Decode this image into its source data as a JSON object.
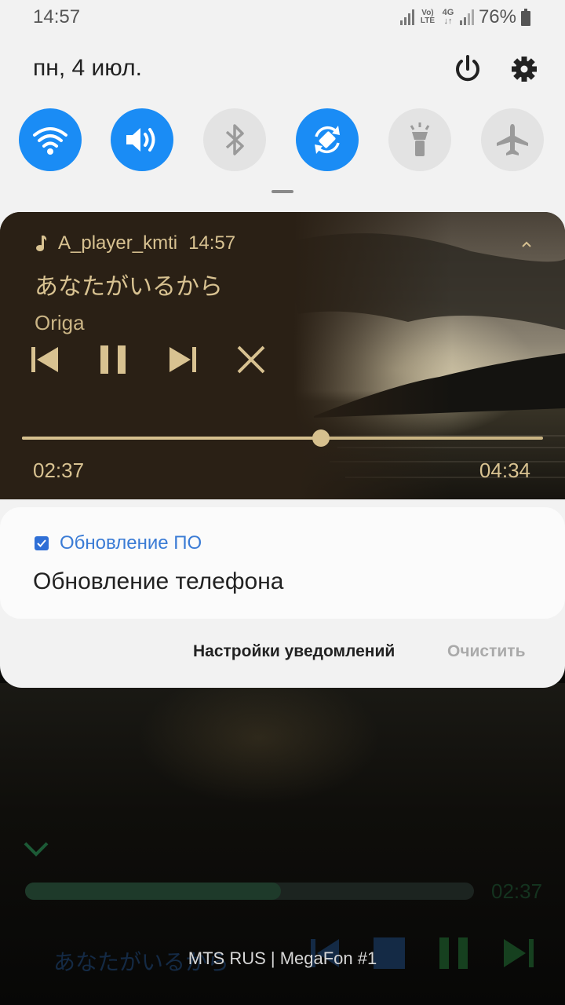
{
  "status_bar": {
    "time": "14:57",
    "network_icons": [
      "signal-icon",
      "volte-icon",
      "4g-icon",
      "signal-icon-2"
    ],
    "battery_percent": "76%",
    "volte_label": "Vo) LTE",
    "net_label": "4G"
  },
  "header": {
    "date": "пн, 4 июл."
  },
  "quick_settings": [
    {
      "name": "wifi",
      "icon": "wifi-icon",
      "on": true
    },
    {
      "name": "sound",
      "icon": "volume-icon",
      "on": true
    },
    {
      "name": "bluetooth",
      "icon": "bluetooth-icon",
      "on": false
    },
    {
      "name": "auto-rotate",
      "icon": "rotate-icon",
      "on": true
    },
    {
      "name": "flashlight",
      "icon": "flashlight-icon",
      "on": false
    },
    {
      "name": "airplane",
      "icon": "airplane-icon",
      "on": false
    }
  ],
  "media": {
    "app": "A_player_kmti",
    "time": "14:57",
    "title": "あなたがいるから",
    "artist": "Origa",
    "current_time": "02:37",
    "total_time": "04:34",
    "progress": 0.574,
    "accent": "#d8c291"
  },
  "system_notification": {
    "app": "Обновление ПО",
    "title": "Обновление телефона"
  },
  "footer": {
    "settings_label": "Настройки уведомлений",
    "clear_label": "Очистить"
  },
  "background_player": {
    "title": "あなたがいるから",
    "current_time": "02:37",
    "progress": 0.57
  },
  "carrier": "MTS RUS | MegaFon #1",
  "colors": {
    "qs_on": "#1a8cf5",
    "qs_off": "#e3e3e3",
    "link_blue": "#3a7bd5"
  }
}
